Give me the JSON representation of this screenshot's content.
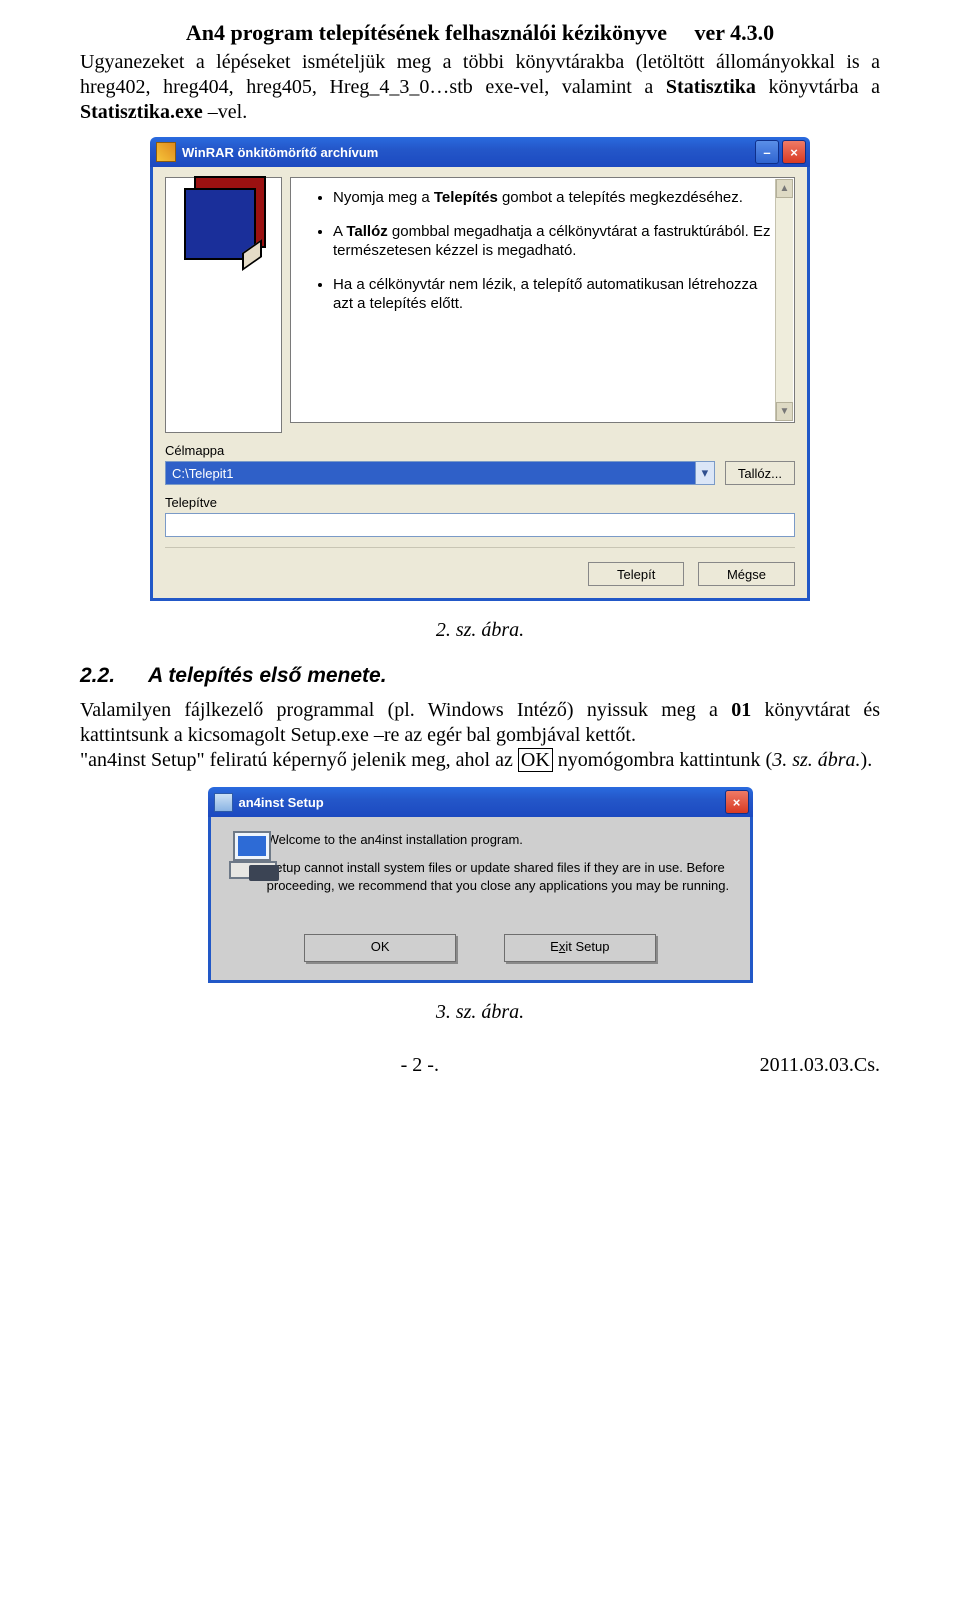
{
  "doc": {
    "header_title": "An4 program telepítésének felhasználói kézikönyve",
    "header_version": "ver 4.3.0",
    "para1_a": "Ugyanezeket a lépéseket ismételjük meg a többi könyvtárakba (letöltött állományokkal is a hreg402, hreg404, hreg405, Hreg_4_3_0…stb exe-vel, valamint a ",
    "para1_b": "Statisztika",
    "para1_c": " könyvtárba a ",
    "para1_d": "Statisztika.exe",
    "para1_e": " –vel.",
    "caption2": "2. sz. ábra.",
    "section_num": "2.2.",
    "section_title": "A telepítés első menete.",
    "para2_a": "Valamilyen fájlkezelő programmal (pl. Windows Intéző) nyissuk meg a ",
    "para2_b": "01",
    "para2_c": " könyvtárat és kattintsunk a kicsomagolt Setup.exe –re az egér bal gombjával kettőt.",
    "para3_a": "\"an4inst Setup\" feliratú képernyő jelenik meg, ahol az ",
    "para3_b": "OK",
    "para3_c": " nyomógombra kattintunk (",
    "para3_d": "3. sz. ábra.",
    "para3_e": ").",
    "caption3": "3. sz. ábra.",
    "footer_page": "- 2 -.",
    "footer_date": "2011.03.03.Cs."
  },
  "winrar": {
    "title": "WinRAR önkitömörítő archívum",
    "b1a": "Nyomja meg a ",
    "b1b": "Telepítés",
    "b1c": " gombot a telepítés megkezdéséhez.",
    "b2a": "A ",
    "b2b": "Tallóz",
    "b2c": " gombbal megadhatja a célkönyvtárat a fastruktúrából. Ez természetesen kézzel is megadható.",
    "b3": "Ha a célkönyvtár nem lézik, a telepítő automatikusan létrehozza azt a telepítés előtt.",
    "dest_label": "Célmappa",
    "dest_value": "C:\\Telepit1",
    "browse_btn": "Tallóz...",
    "progress_label": "Telepítve",
    "install_btn": "Telepít",
    "cancel_btn": "Mégse"
  },
  "setup": {
    "title": "an4inst Setup",
    "line1": "Welcome to the an4inst installation program.",
    "line2": "Setup cannot install system files or update shared files if they are in use. Before proceeding, we recommend that you close any applications you may be running.",
    "ok_btn": "OK",
    "exit_pre": "E",
    "exit_u": "x",
    "exit_post": "it Setup"
  }
}
